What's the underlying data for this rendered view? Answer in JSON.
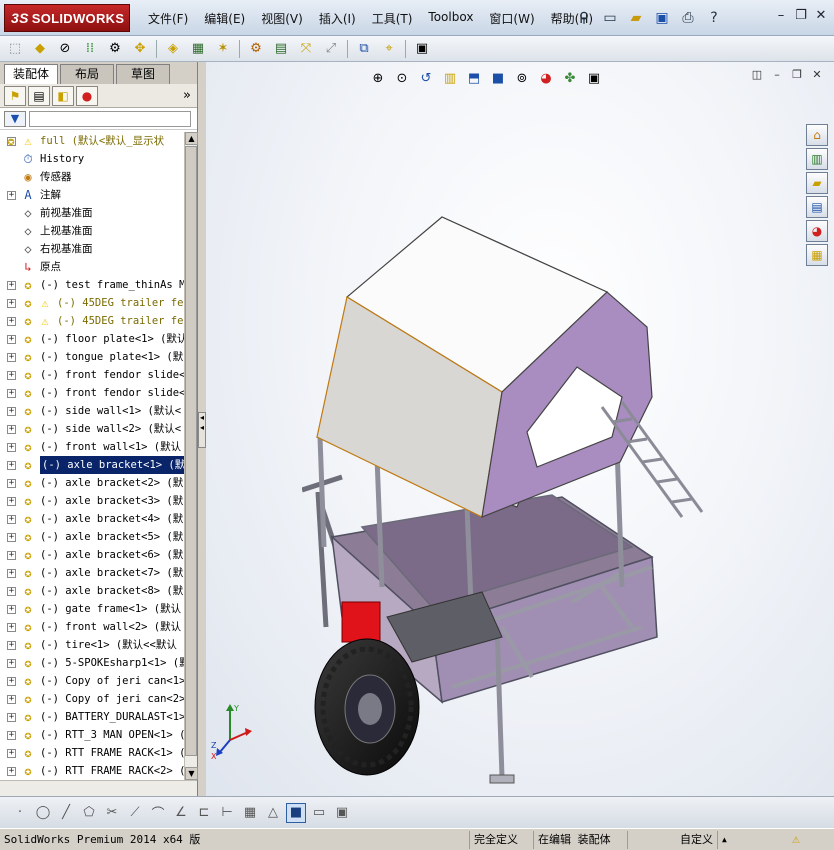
{
  "app": {
    "brand_prefix": "3S",
    "brand_name": "SOLIDWORKS"
  },
  "menu": [
    "文件(F)",
    "编辑(E)",
    "视图(V)",
    "插入(I)",
    "工具(T)",
    "Toolbox",
    "窗口(W)",
    "帮助(H)"
  ],
  "feature_manager": {
    "tabs": [
      "装配体",
      "布局",
      "草图"
    ],
    "active_tab": "装配体",
    "tree": [
      {
        "label": "full  (默认<默认_显示状",
        "icon": "assembly-icon",
        "warn": true,
        "expander": "minus",
        "level": 0
      },
      {
        "label": "History",
        "icon": "history-icon",
        "level": 1
      },
      {
        "label": "传感器",
        "icon": "sensor-icon",
        "level": 1
      },
      {
        "label": "注解",
        "icon": "annotation-icon",
        "expander": "plus",
        "level": 1
      },
      {
        "label": "前视基准面",
        "icon": "plane-icon",
        "level": 1
      },
      {
        "label": "上视基准面",
        "icon": "plane-icon",
        "level": 1
      },
      {
        "label": "右视基准面",
        "icon": "plane-icon",
        "level": 1
      },
      {
        "label": "原点",
        "icon": "origin-icon",
        "level": 1
      },
      {
        "label": "(-) test frame_thinAs M",
        "icon": "part-icon",
        "expander": "plus",
        "level": 1
      },
      {
        "label": "(-) 45DEG trailer fe",
        "icon": "part-icon",
        "warn": true,
        "expander": "plus",
        "level": 1
      },
      {
        "label": "(-) 45DEG trailer fe",
        "icon": "part-icon",
        "warn": true,
        "expander": "plus",
        "level": 1
      },
      {
        "label": "(-) floor plate<1> (默认",
        "icon": "part-icon",
        "expander": "plus",
        "level": 1
      },
      {
        "label": "(-) tongue plate<1> (默",
        "icon": "part-icon",
        "expander": "plus",
        "level": 1
      },
      {
        "label": "(-) front fendor slide<",
        "icon": "part-icon",
        "expander": "plus",
        "level": 1
      },
      {
        "label": "(-) front fendor slide<",
        "icon": "part-icon",
        "expander": "plus",
        "level": 1
      },
      {
        "label": "(-) side wall<1> (默认<",
        "icon": "part-icon",
        "expander": "plus",
        "level": 1
      },
      {
        "label": "(-) side wall<2> (默认<",
        "icon": "part-icon",
        "expander": "plus",
        "level": 1
      },
      {
        "label": "(-) front wall<1> (默认",
        "icon": "part-icon",
        "expander": "plus",
        "level": 1
      },
      {
        "label": "(-) axle bracket<1> (默",
        "icon": "part-icon",
        "expander": "plus",
        "level": 1,
        "selected": true
      },
      {
        "label": "(-) axle bracket<2> (默",
        "icon": "part-icon",
        "expander": "plus",
        "level": 1
      },
      {
        "label": "(-) axle bracket<3> (默",
        "icon": "part-icon",
        "expander": "plus",
        "level": 1
      },
      {
        "label": "(-) axle bracket<4> (默",
        "icon": "part-icon",
        "expander": "plus",
        "level": 1
      },
      {
        "label": "(-) axle bracket<5> (默",
        "icon": "part-icon",
        "expander": "plus",
        "level": 1
      },
      {
        "label": "(-) axle bracket<6> (默",
        "icon": "part-icon",
        "expander": "plus",
        "level": 1
      },
      {
        "label": "(-) axle bracket<7> (默",
        "icon": "part-icon",
        "expander": "plus",
        "level": 1
      },
      {
        "label": "(-) axle bracket<8> (默",
        "icon": "part-icon",
        "expander": "plus",
        "level": 1
      },
      {
        "label": "(-) gate frame<1> (默认",
        "icon": "part-icon",
        "expander": "plus",
        "level": 1
      },
      {
        "label": "(-) front wall<2> (默认",
        "icon": "part-icon",
        "expander": "plus",
        "level": 1
      },
      {
        "label": "(-) tire<1> (默认<<默认",
        "icon": "part-icon",
        "expander": "plus",
        "level": 1
      },
      {
        "label": "(-) 5-SPOKEsharp1<1> (默",
        "icon": "part-icon",
        "expander": "plus",
        "level": 1
      },
      {
        "label": "(-) Copy of jeri can<1>",
        "icon": "part-icon",
        "expander": "plus",
        "level": 1
      },
      {
        "label": "(-) Copy of jeri can<2>",
        "icon": "part-icon",
        "expander": "plus",
        "level": 1
      },
      {
        "label": "(-) BATTERY_DURALAST<1>",
        "icon": "part-icon",
        "expander": "plus",
        "level": 1
      },
      {
        "label": "(-) RTT_3 MAN OPEN<1> (",
        "icon": "part-icon",
        "expander": "plus",
        "level": 1
      },
      {
        "label": "(-) RTT FRAME RACK<1> (",
        "icon": "part-icon",
        "expander": "plus",
        "level": 1
      },
      {
        "label": "(-) RTT FRAME RACK<2> (",
        "icon": "part-icon",
        "expander": "plus",
        "level": 1
      }
    ]
  },
  "triad": {
    "x": "X",
    "y": "Y",
    "z": "Z"
  },
  "status": {
    "version": "SolidWorks Premium 2014 x64 版",
    "definition": "完全定义",
    "mode": "在编辑 装配体",
    "units": "自定义",
    "units_caret": "▲"
  },
  "colors": {
    "selection": "#0a246a",
    "warning": "#f5c400",
    "tent_side": "#a98cc0",
    "battery": "#e0121a",
    "tube": "#9a9aa6"
  }
}
